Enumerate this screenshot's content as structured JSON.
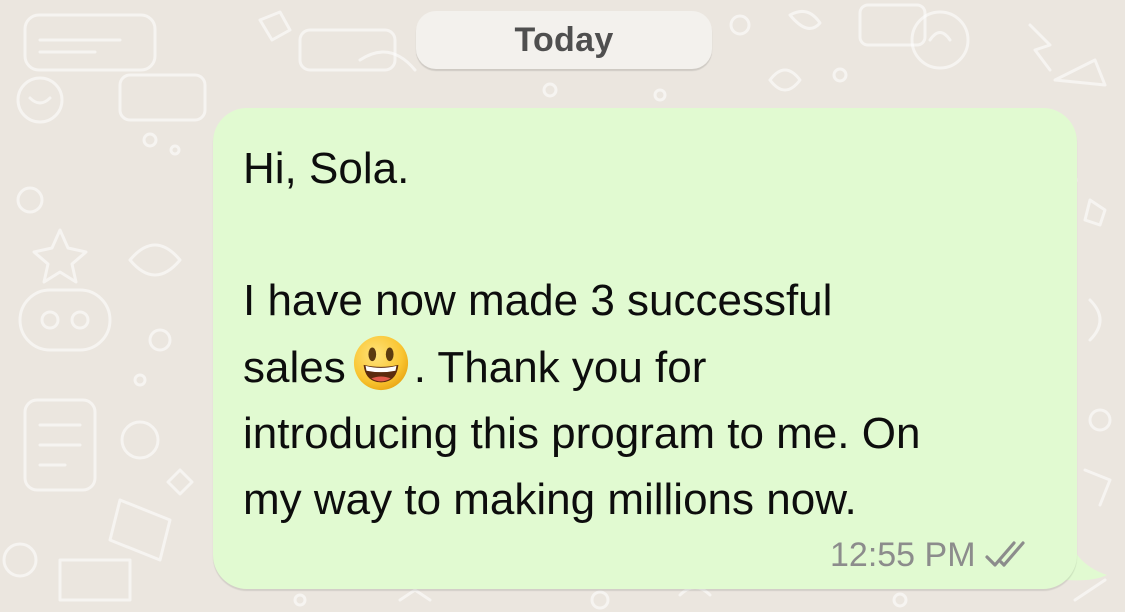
{
  "date_divider": {
    "label": "Today"
  },
  "message": {
    "direction": "outgoing",
    "greeting": "Hi, Sola.",
    "line1": "I have now made 3 successful",
    "line2_before_emoji": "sales",
    "emoji_name": "grinning-face-with-big-eyes-emoji",
    "line2_after_emoji": ". Thank you for",
    "line3": "introducing this program to me. On",
    "line4": "my way to making millions now.",
    "time": "12:55 PM",
    "status_icon": "double-check-icon"
  },
  "colors": {
    "chat_background": "#ebe6df",
    "outgoing_bubble": "#e1fad1",
    "date_pill": "#f3f1ed",
    "text": "#0d0d0d",
    "meta_text": "#8c8c8c"
  }
}
